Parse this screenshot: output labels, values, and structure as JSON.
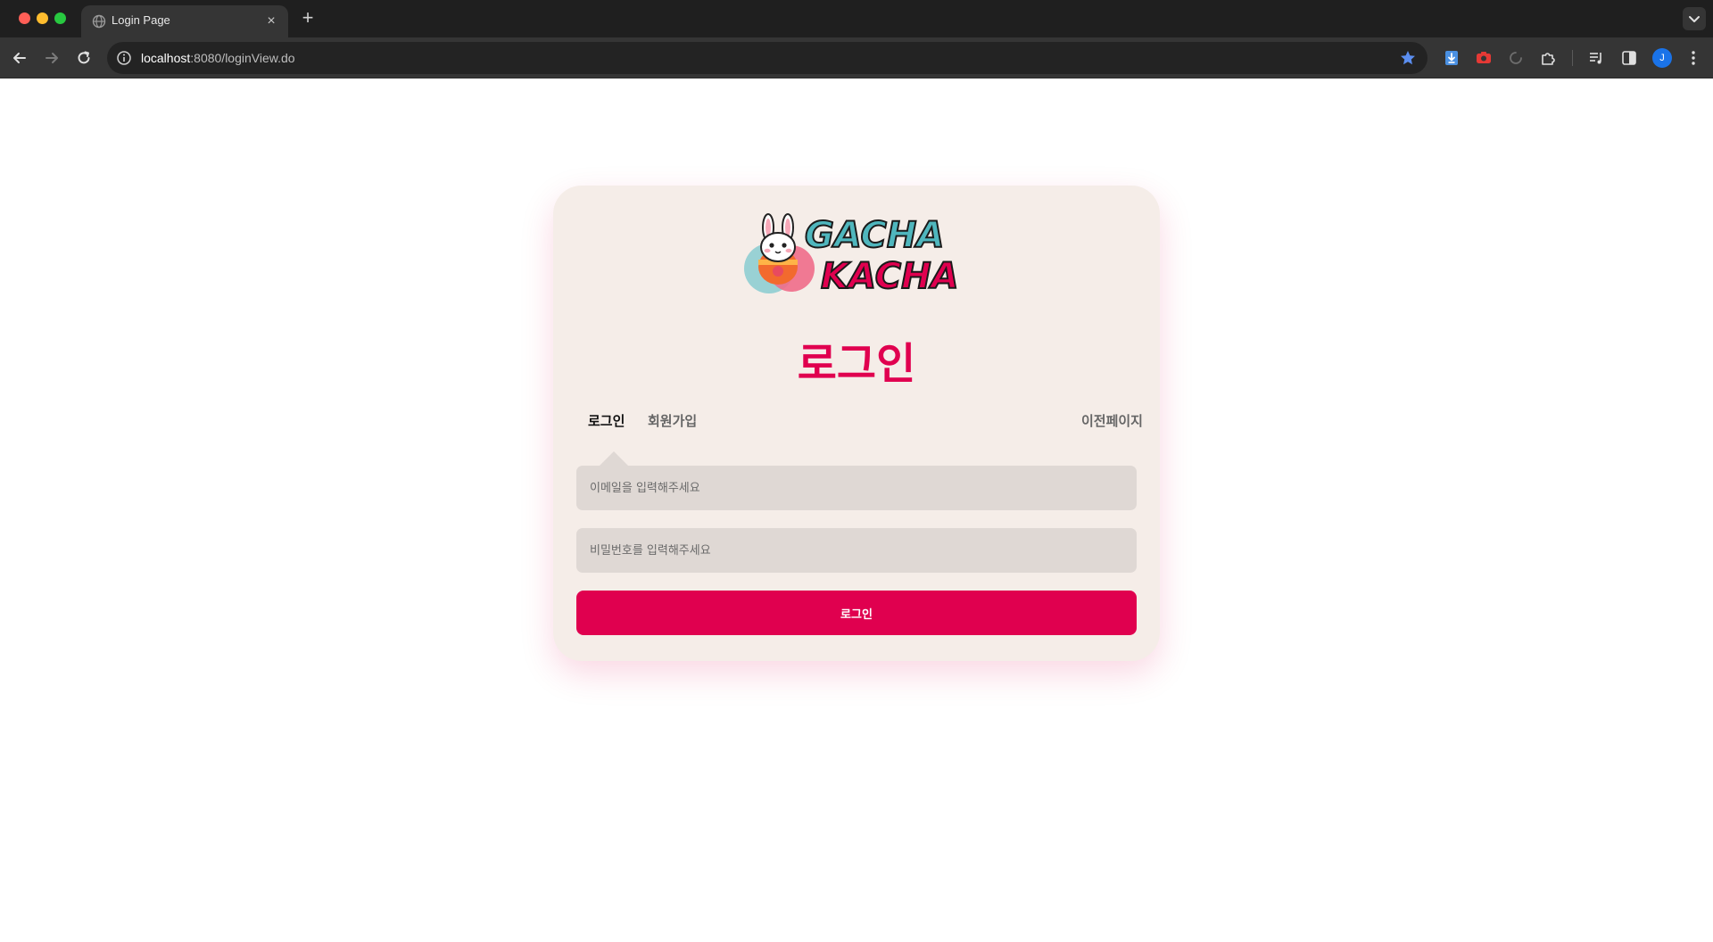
{
  "browser": {
    "tab_title": "Login Page",
    "tab_close": "×",
    "new_tab": "+",
    "url_host": "localhost",
    "url_rest": ":8080/loginView.do",
    "profile_initial": "J",
    "colors": {
      "traffic_red": "#ff5f57",
      "traffic_yellow": "#febc2e",
      "traffic_green": "#28c840",
      "star": "#5b8ef0",
      "profile": "#1a73e8"
    },
    "extension_icons": [
      "download-extension-icon",
      "camera-extension-icon",
      "loading-spinner-icon",
      "puzzle-extensions-icon",
      "media-control-icon",
      "side-panel-icon"
    ]
  },
  "page": {
    "logo_line1": "GACHA",
    "logo_line2": "KACHA",
    "heading": "로그인",
    "tabs": {
      "login": "로그인",
      "signup": "회원가입"
    },
    "prev_page": "이전페이지",
    "email_placeholder": "이메일을 입력해주세요",
    "password_placeholder": "비밀번호를 입력해주세요",
    "submit_label": "로그인",
    "colors": {
      "accent": "#e0004f",
      "card_bg": "#f5ede8",
      "field_bg": "#dfd8d4",
      "logo_teal": "#4fb6bd"
    }
  }
}
